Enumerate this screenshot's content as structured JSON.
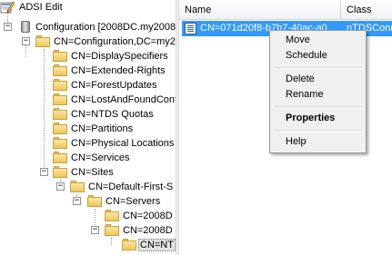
{
  "tree": {
    "root_label": "ADSI Edit",
    "connection_label": "Configuration [2008DC.my2008",
    "items": [
      {
        "label": "CN=Configuration,DC=my2"
      },
      {
        "label": "CN=DisplaySpecifiers"
      },
      {
        "label": "CN=Extended-Rights"
      },
      {
        "label": "CN=ForestUpdates"
      },
      {
        "label": "CN=LostAndFoundConf"
      },
      {
        "label": "CN=NTDS Quotas"
      },
      {
        "label": "CN=Partitions"
      },
      {
        "label": "CN=Physical Locations"
      },
      {
        "label": "CN=Services"
      },
      {
        "label": "CN=Sites"
      },
      {
        "label": "CN=Default-First-S"
      },
      {
        "label": "CN=Servers"
      },
      {
        "label": "CN=2008D"
      },
      {
        "label": "CN=2008D"
      },
      {
        "label": "CN=NT"
      }
    ],
    "expander_minus": "−",
    "expander_plus": "+"
  },
  "list": {
    "columns": [
      {
        "label": "Name"
      },
      {
        "label": "Class"
      }
    ],
    "rows": [
      {
        "name": "CN=071d20f8-b7b7-40ac-a0",
        "class": "nTDSConn"
      }
    ]
  },
  "context_menu": {
    "items": [
      "Move",
      "Schedule",
      "Delete",
      "Rename",
      "Properties",
      "Help"
    ]
  },
  "colors": {
    "selection": "#3399ff",
    "menu_background": "#f0f0f0",
    "folder": "#efc75a"
  }
}
